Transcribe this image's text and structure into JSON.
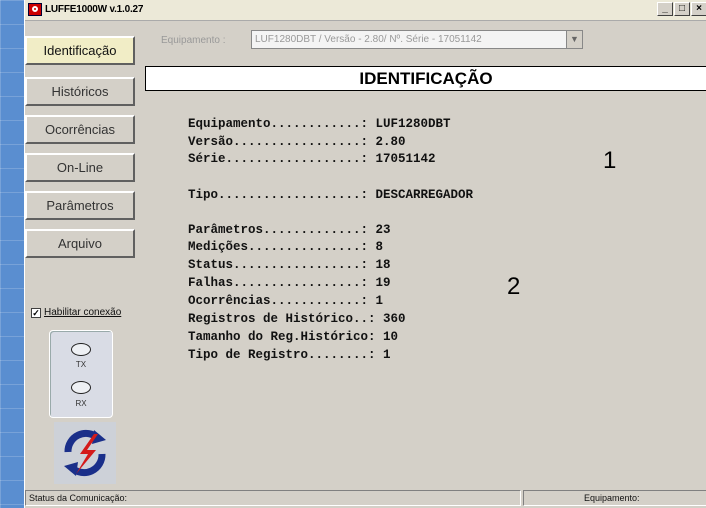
{
  "window": {
    "title": "LUFFE1000W v.1.0.27"
  },
  "nav": [
    {
      "label": "Identificação",
      "active": true
    },
    {
      "label": "Históricos"
    },
    {
      "label": "Ocorrências"
    },
    {
      "label": "On-Line"
    },
    {
      "label": "Parâmetros"
    },
    {
      "label": "Arquivo"
    }
  ],
  "equipment": {
    "label": "Equipamento :",
    "selected": "LUF1280DBT / Versão - 2.80/ Nº. Série - 17051142"
  },
  "panel": {
    "title": "IDENTIFICAÇÃO"
  },
  "info_group1": [
    {
      "label": "Equipamento............:",
      "value": "LUF1280DBT"
    },
    {
      "label": "Versão.................:",
      "value": "2.80"
    },
    {
      "label": "Série..................:",
      "value": "17051142"
    }
  ],
  "info_tipo": {
    "label": "Tipo...................:",
    "value": "DESCARREGADOR"
  },
  "info_group2": [
    {
      "label": "Parâmetros.............:",
      "value": "23"
    },
    {
      "label": "Medições...............:",
      "value": "8"
    },
    {
      "label": "Status.................:",
      "value": "18"
    },
    {
      "label": "Falhas.................:",
      "value": "19"
    },
    {
      "label": "Ocorrências............:",
      "value": "1"
    },
    {
      "label": "Registros de Histórico..:",
      "value": "360"
    },
    {
      "label": "Tamanho do Reg.Histórico:",
      "value": "10"
    },
    {
      "label": "Tipo de Registro........:",
      "value": "1"
    }
  ],
  "annotations": {
    "one": "1",
    "two": "2"
  },
  "connection": {
    "checkbox_label": "Habilitar conexão",
    "checked": true,
    "tx": "TX",
    "rx": "RX"
  },
  "statusbar": {
    "left": "Status da Comunicação:",
    "right": "Equipamento:"
  }
}
